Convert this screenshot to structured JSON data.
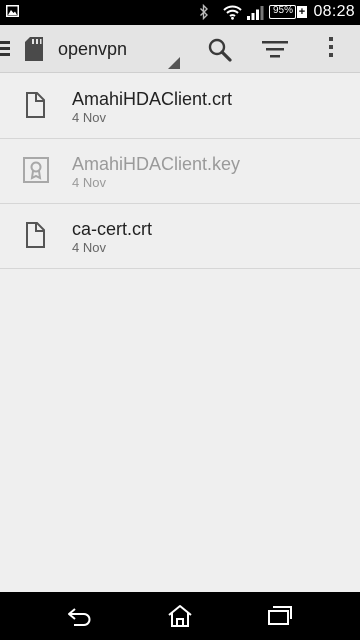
{
  "status_bar": {
    "battery_percent": "95%",
    "charging_symbol": "+",
    "time": "08:28",
    "icons": [
      "gallery-icon",
      "bluetooth-icon",
      "wifi-icon",
      "signal-icon",
      "battery-icon"
    ]
  },
  "action_bar": {
    "title": "openvpn",
    "icons": [
      "drawer-icon",
      "sd-card-icon",
      "search-icon",
      "sort-icon",
      "overflow-menu-icon"
    ]
  },
  "files": [
    {
      "name": "AmahiHDAClient.crt",
      "date": "4 Nov",
      "icon": "document-icon",
      "enabled": true
    },
    {
      "name": "AmahiHDAClient.key",
      "date": "4 Nov",
      "icon": "certificate-icon",
      "enabled": false
    },
    {
      "name": "ca-cert.crt",
      "date": "4 Nov",
      "icon": "document-icon",
      "enabled": true
    }
  ],
  "nav_bar": {
    "icons": [
      "back-icon",
      "home-icon",
      "recents-icon"
    ]
  },
  "colors": {
    "background": "#efefef",
    "action_bar": "#e4e4e4",
    "divider": "#d6d6d6",
    "text_primary": "#222222",
    "text_disabled": "#9a9a9a"
  }
}
